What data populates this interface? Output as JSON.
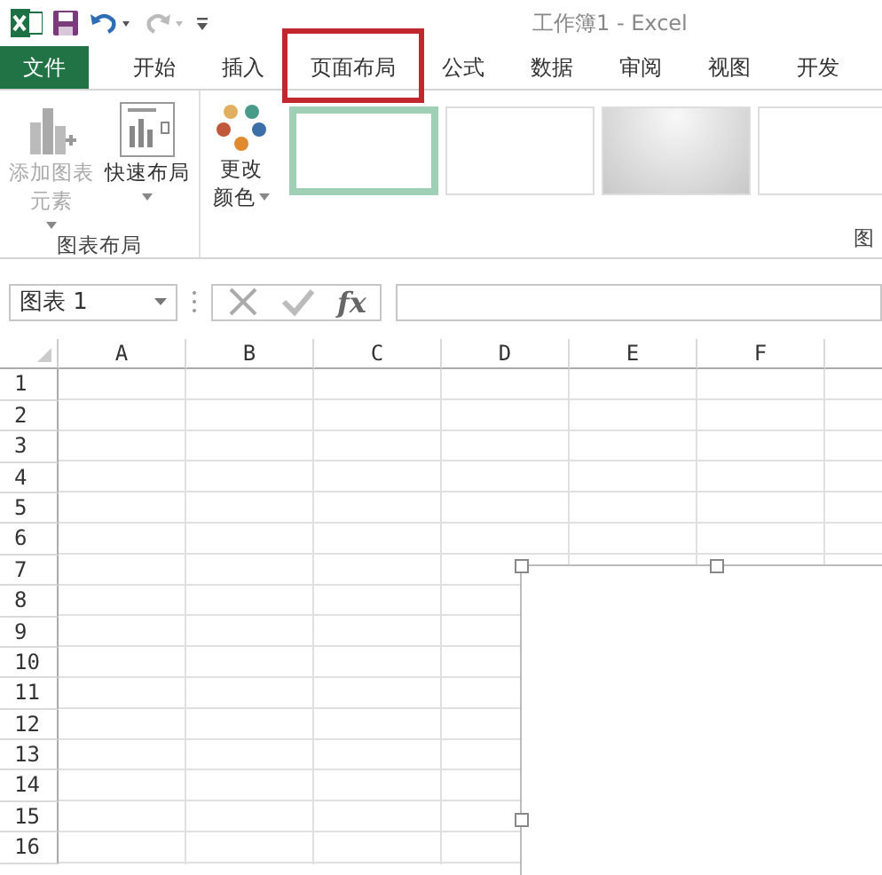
{
  "window": {
    "title": "工作簿1 - Excel"
  },
  "tabs": [
    {
      "label": "文件",
      "kind": "file",
      "annotated": false
    },
    {
      "label": "开始",
      "kind": "tab",
      "annotated": false
    },
    {
      "label": "插入",
      "kind": "tab",
      "annotated": false
    },
    {
      "label": "页面布局",
      "kind": "tab",
      "annotated": true
    },
    {
      "label": "公式",
      "kind": "tab",
      "annotated": false
    },
    {
      "label": "数据",
      "kind": "tab",
      "annotated": false
    },
    {
      "label": "审阅",
      "kind": "tab",
      "annotated": false
    },
    {
      "label": "视图",
      "kind": "tab",
      "annotated": false
    },
    {
      "label": "开发",
      "kind": "tab",
      "annotated": false
    }
  ],
  "ribbon": {
    "groups": [
      {
        "label": "图表布局",
        "buttons": [
          {
            "lines": [
              "添加图表",
              "元素"
            ],
            "kind": "add-element",
            "disabled": true
          },
          {
            "lines": [
              "快速布局"
            ],
            "kind": "layout",
            "disabled": false
          }
        ]
      },
      {
        "buttons": [
          {
            "lines": [
              "更改",
              "颜色"
            ],
            "kind": "colors",
            "disabled": false
          }
        ],
        "styles": [
          {
            "kind": "plain",
            "selected": true
          },
          {
            "kind": "plain",
            "selected": false
          },
          {
            "kind": "gradient",
            "selected": false
          },
          {
            "kind": "plain",
            "selected": false
          }
        ],
        "label": "图"
      }
    ]
  },
  "formula_bar": {
    "name_box": "图表 1",
    "function_label": "fx"
  },
  "sheet": {
    "columns": [
      "A",
      "B",
      "C",
      "D",
      "E",
      "F"
    ],
    "rows": [
      "1",
      "2",
      "3",
      "4",
      "5",
      "6",
      "7",
      "8",
      "9",
      "10",
      "11",
      "12",
      "13",
      "14",
      "15",
      "16"
    ]
  }
}
